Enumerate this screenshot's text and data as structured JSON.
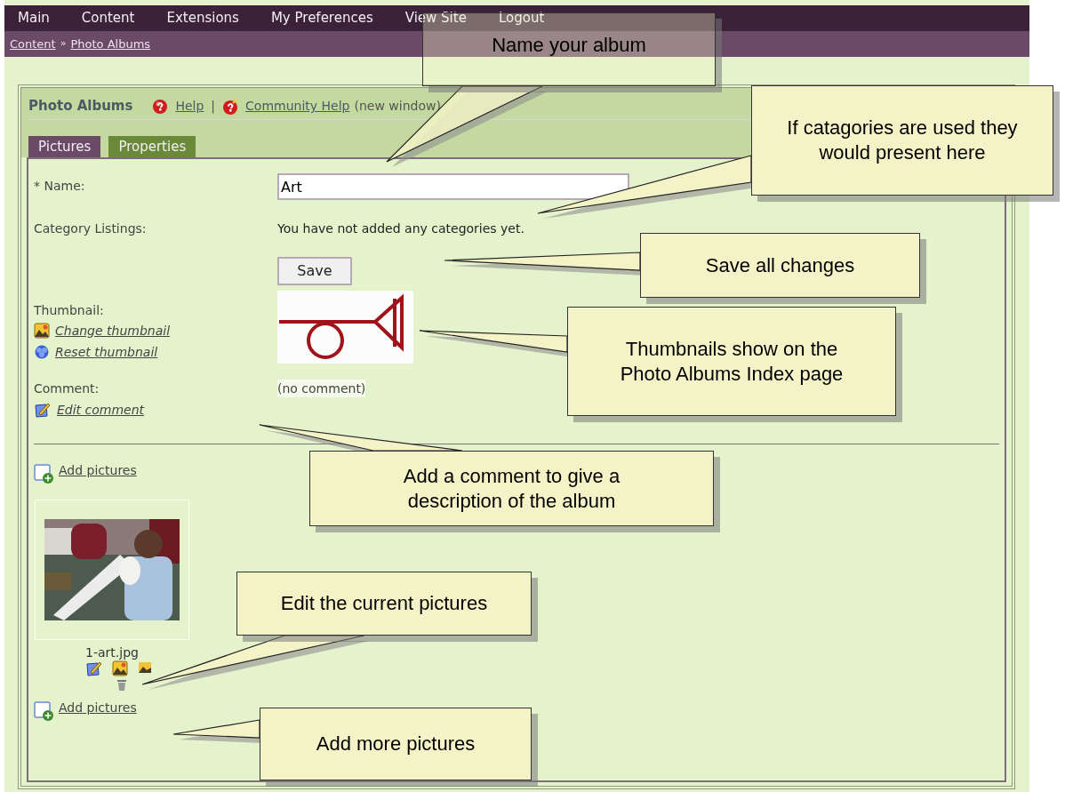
{
  "nav": {
    "items": [
      {
        "label": "Main"
      },
      {
        "label": "Content"
      },
      {
        "label": "Extensions"
      },
      {
        "label": "My Preferences"
      },
      {
        "label": "View Site"
      },
      {
        "label": "Logout"
      }
    ]
  },
  "breadcrumb": {
    "links": [
      "Content",
      "Photo Albums"
    ],
    "separator": "»"
  },
  "panel": {
    "title": "Photo Albums",
    "help_links": [
      {
        "label": "Help",
        "kind": "help"
      },
      {
        "label": "Community Help",
        "kind": "community"
      }
    ],
    "separator": "|",
    "note": "(new window)"
  },
  "tabs": [
    {
      "label": "Pictures",
      "selected": true
    },
    {
      "label": "Properties",
      "selected": false
    }
  ],
  "form": {
    "name_label": "* Name:",
    "name_value": "Art",
    "category_label": "Category Listings:",
    "category_text": "You have not added any categories yet.",
    "save_button": "Save",
    "thumbnail_label": "Thumbnail:",
    "thumbnail_actions": [
      {
        "label": "Change thumbnail",
        "kind": "change"
      },
      {
        "label": "Reset thumbnail",
        "kind": "reset"
      }
    ],
    "comment_label": "Comment:",
    "comment_value": "(no comment)",
    "comment_action": "Edit comment"
  },
  "add_pictures_top": "Add pictures",
  "pictures": [
    {
      "kind": "picture",
      "filename": "1-art.jpg"
    }
  ],
  "add_pictures_bottom": "Add pictures",
  "callouts": [
    {
      "text": "Name your album"
    },
    {
      "text": "If catagories are used they would present here"
    },
    {
      "text": "Save all changes"
    },
    {
      "text": "Thumbnails show on the Photo Albums Index page"
    },
    {
      "text": "Add a comment to give a description of the album"
    },
    {
      "text": "Edit the current pictures"
    },
    {
      "text": "Add more pictures"
    }
  ]
}
